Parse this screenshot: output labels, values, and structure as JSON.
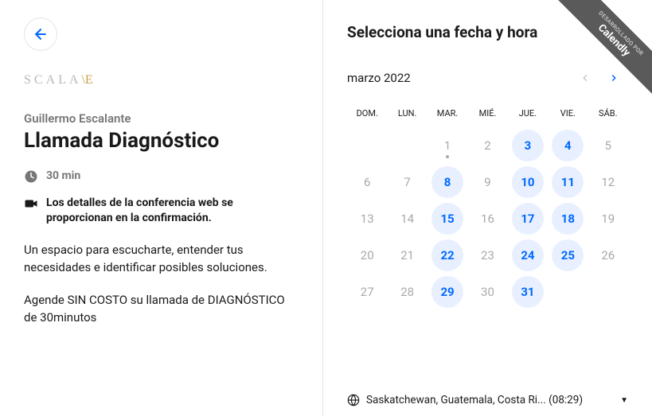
{
  "ribbon": {
    "small": "DESARROLLADO POR",
    "big": "Calendly"
  },
  "left": {
    "logo_main": "SCALA",
    "logo_suffix": "\\E",
    "organizer": "Guillermo Escalante",
    "title": "Llamada Diagnóstico",
    "duration": "30 min",
    "conference_note": "Los detalles de la conferencia web se proporcionan en la confirmación.",
    "description_p1": "Un espacio para escucharte, entender tus necesidades e identificar posibles soluciones.",
    "description_p2": "Agende SIN COSTO su llamada de DIAGNÓSTICO de 30minutos"
  },
  "right": {
    "heading": "Selecciona una fecha y hora",
    "month_label": "marzo 2022",
    "weekdays": [
      "DOM.",
      "LUN.",
      "MAR.",
      "MIÉ.",
      "JUE.",
      "VIE.",
      "SÁB."
    ],
    "days": [
      {
        "n": "",
        "s": "blank"
      },
      {
        "n": "",
        "s": "blank"
      },
      {
        "n": "1",
        "s": "today"
      },
      {
        "n": "2",
        "s": "unavailable"
      },
      {
        "n": "3",
        "s": "available"
      },
      {
        "n": "4",
        "s": "available"
      },
      {
        "n": "5",
        "s": "unavailable"
      },
      {
        "n": "6",
        "s": "unavailable"
      },
      {
        "n": "7",
        "s": "unavailable"
      },
      {
        "n": "8",
        "s": "available"
      },
      {
        "n": "9",
        "s": "unavailable"
      },
      {
        "n": "10",
        "s": "available"
      },
      {
        "n": "11",
        "s": "available"
      },
      {
        "n": "12",
        "s": "unavailable"
      },
      {
        "n": "13",
        "s": "unavailable"
      },
      {
        "n": "14",
        "s": "unavailable"
      },
      {
        "n": "15",
        "s": "available"
      },
      {
        "n": "16",
        "s": "unavailable"
      },
      {
        "n": "17",
        "s": "available"
      },
      {
        "n": "18",
        "s": "available"
      },
      {
        "n": "19",
        "s": "unavailable"
      },
      {
        "n": "20",
        "s": "unavailable"
      },
      {
        "n": "21",
        "s": "unavailable"
      },
      {
        "n": "22",
        "s": "available"
      },
      {
        "n": "23",
        "s": "unavailable"
      },
      {
        "n": "24",
        "s": "available"
      },
      {
        "n": "25",
        "s": "available"
      },
      {
        "n": "26",
        "s": "unavailable"
      },
      {
        "n": "27",
        "s": "unavailable"
      },
      {
        "n": "28",
        "s": "unavailable"
      },
      {
        "n": "29",
        "s": "available"
      },
      {
        "n": "30",
        "s": "unavailable"
      },
      {
        "n": "31",
        "s": "available"
      },
      {
        "n": "",
        "s": "blank"
      },
      {
        "n": "",
        "s": "blank"
      }
    ],
    "timezone_text": "Saskatchewan, Guatemala, Costa Ri...",
    "timezone_time": "(08:29)"
  }
}
